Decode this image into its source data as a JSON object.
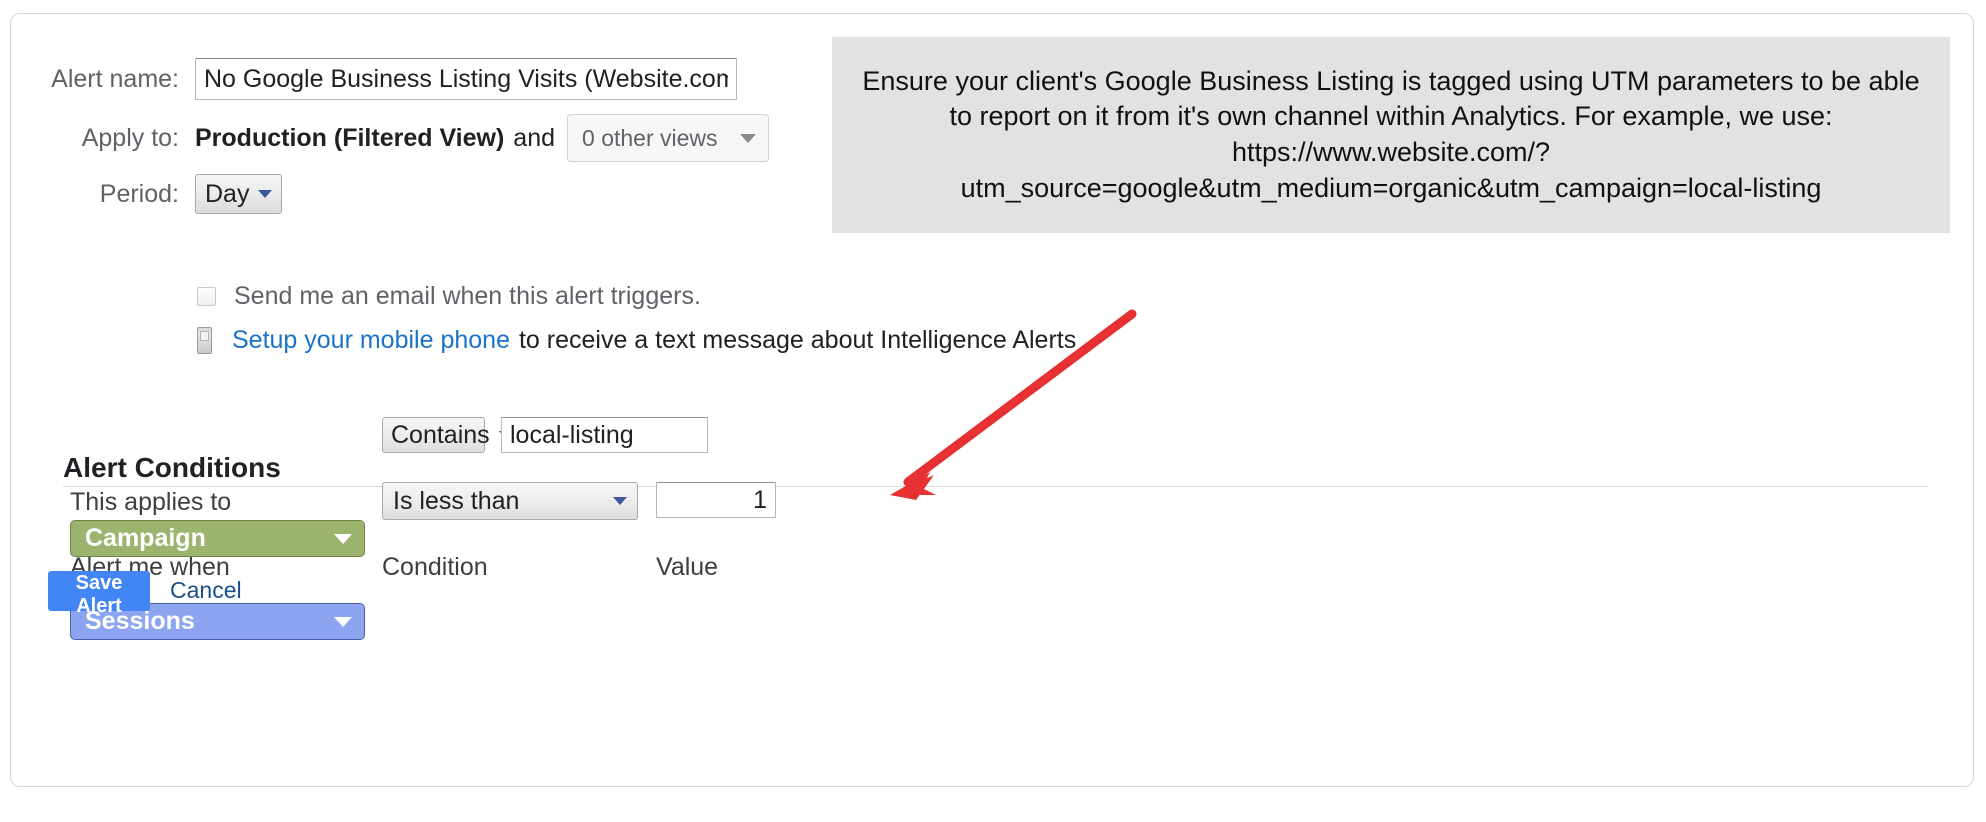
{
  "form": {
    "alert_name": {
      "label": "Alert name:",
      "value": "No Google Business Listing Visits (Website.com)",
      "placeholder": "Alert name"
    },
    "apply_to": {
      "label": "Apply to:",
      "view_name": "Production (Filtered View)",
      "conjunction": "and",
      "other_views_value": "0 other views"
    },
    "period": {
      "label": "Period:",
      "value": "Day"
    },
    "email_option": {
      "text": "Send me an email when this alert triggers.",
      "checked": false
    },
    "mobile_option": {
      "link_text": "Setup your mobile phone",
      "trailing_text": "to receive a text message about Intelligence Alerts"
    }
  },
  "callout": {
    "text": "Ensure your client's Google Business Listing is tagged using UTM parameters to be able to report on it from it's own channel within Analytics. For example, we use: https://www.website.com/?utm_source=google&utm_medium=organic&utm_campaign=local-listing",
    "background_color": "#e2e2e2"
  },
  "annotation": {
    "arrow_color": "#e63232"
  },
  "conditions": {
    "title": "Alert Conditions",
    "row1": {
      "applies_to_header": "This applies to",
      "applies_to_value": "Campaign",
      "applies_to_color": "#9cb46e",
      "condition_header": "Condition",
      "condition_value": "Contains",
      "value_header": "Value",
      "value": "local-listing"
    },
    "row2": {
      "alert_when_header": "Alert me when",
      "alert_when_value": "Sessions",
      "alert_when_color": "#8da4f0",
      "condition_header": "Condition",
      "condition_value": "Is less than",
      "value_header": "Value",
      "value": "1"
    }
  },
  "footer": {
    "save_label": "Save Alert",
    "cancel_label": "Cancel",
    "save_color": "#4285f4"
  }
}
